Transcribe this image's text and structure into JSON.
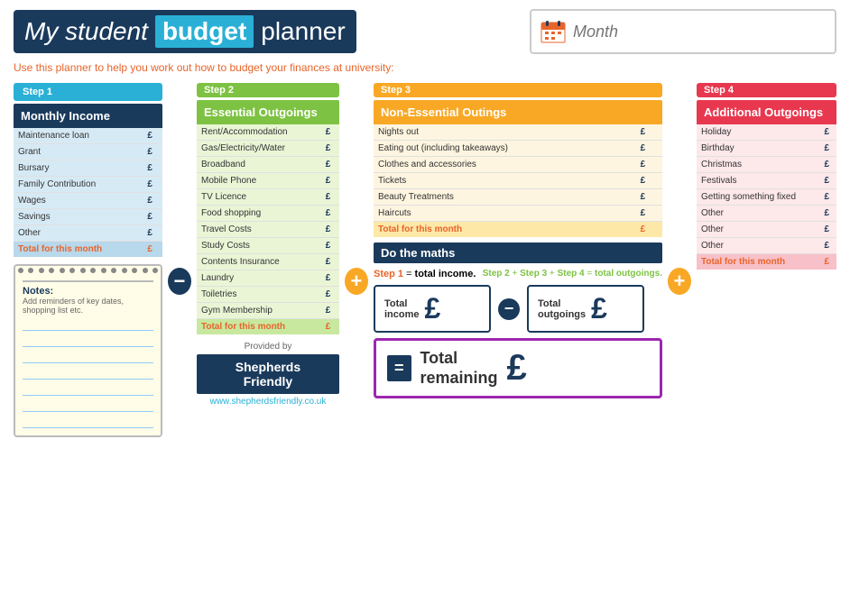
{
  "header": {
    "title_my": "My student",
    "title_budget": "budget",
    "title_planner": "planner",
    "month_placeholder": "Month"
  },
  "subtitle": "Use this planner to help you work out how to budget your finances at university:",
  "step1": {
    "label": "Step 1",
    "header": "Monthly Income",
    "items": [
      {
        "label": "Maintenance loan",
        "value": "£"
      },
      {
        "label": "Grant",
        "value": "£"
      },
      {
        "label": "Bursary",
        "value": "£"
      },
      {
        "label": "Family Contribution",
        "value": "£"
      },
      {
        "label": "Wages",
        "value": "£"
      },
      {
        "label": "Savings",
        "value": "£"
      },
      {
        "label": "Other",
        "value": "£"
      },
      {
        "label": "Total for this month",
        "value": "£"
      }
    ]
  },
  "step2": {
    "label": "Step 2",
    "header": "Essential Outgoings",
    "items": [
      {
        "label": "Rent/Accommodation",
        "value": "£"
      },
      {
        "label": "Gas/Electricity/Water",
        "value": "£"
      },
      {
        "label": "Broadband",
        "value": "£"
      },
      {
        "label": "Mobile Phone",
        "value": "£"
      },
      {
        "label": "TV Licence",
        "value": "£"
      },
      {
        "label": "Food shopping",
        "value": "£"
      },
      {
        "label": "Travel Costs",
        "value": "£"
      },
      {
        "label": "Study Costs",
        "value": "£"
      },
      {
        "label": "Contents Insurance",
        "value": "£"
      },
      {
        "label": "Laundry",
        "value": "£"
      },
      {
        "label": "Toiletries",
        "value": "£"
      },
      {
        "label": "Gym Membership",
        "value": "£"
      },
      {
        "label": "Total for this month",
        "value": "£"
      }
    ]
  },
  "step3": {
    "label": "Step 3",
    "header": "Non-Essential Outings",
    "items": [
      {
        "label": "Nights out",
        "value": "£"
      },
      {
        "label": "Eating out (including takeaways)",
        "value": "£"
      },
      {
        "label": "Clothes and accessories",
        "value": "£"
      },
      {
        "label": "Tickets",
        "value": "£"
      },
      {
        "label": "Beauty Treatments",
        "value": "£"
      },
      {
        "label": "Haircuts",
        "value": "£"
      },
      {
        "label": "Total for this month",
        "value": "£"
      }
    ]
  },
  "step4": {
    "label": "Step 4",
    "header": "Additional Outgoings",
    "items": [
      {
        "label": "Holiday",
        "value": "£"
      },
      {
        "label": "Birthday",
        "value": "£"
      },
      {
        "label": "Christmas",
        "value": "£"
      },
      {
        "label": "Festivals",
        "value": "£"
      },
      {
        "label": "Getting something fixed",
        "value": "£"
      },
      {
        "label": "Other",
        "value": "£"
      },
      {
        "label": "Other",
        "value": "£"
      },
      {
        "label": "Other",
        "value": "£"
      },
      {
        "label": "Total for this month",
        "value": "£"
      }
    ]
  },
  "notes": {
    "title": "Notes:",
    "subtitle": "Add reminders of key dates, shopping list etc."
  },
  "shepherds": {
    "provided_by": "Provided by",
    "brand": "Shepherds Friendly",
    "url": "www.shepherdsfriendly.co.uk"
  },
  "maths": {
    "title": "Do the maths",
    "step1_text": "Step 1 = total income.",
    "step234_text": "Step 2 + Step 3 + Step 4 = total outgoings.",
    "total_income_label": "Total\nincome",
    "total_outgoings_label": "Total\noutgoings",
    "total_remaining_label": "Total\nremaining",
    "pound": "£"
  }
}
